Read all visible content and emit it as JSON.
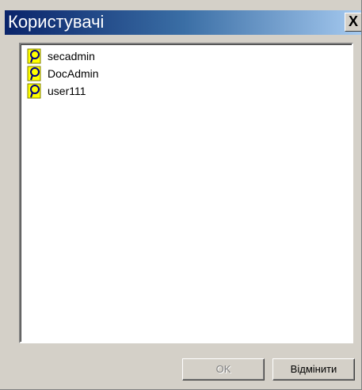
{
  "dialog": {
    "title": "Користувачі",
    "close_label": "X"
  },
  "users": {
    "items": [
      {
        "label": "secadmin",
        "icon": "user-icon"
      },
      {
        "label": "DocAdmin",
        "icon": "user-icon"
      },
      {
        "label": "user111",
        "icon": "user-icon"
      }
    ]
  },
  "buttons": {
    "ok_label": "OK",
    "cancel_label": "Відмінити"
  }
}
